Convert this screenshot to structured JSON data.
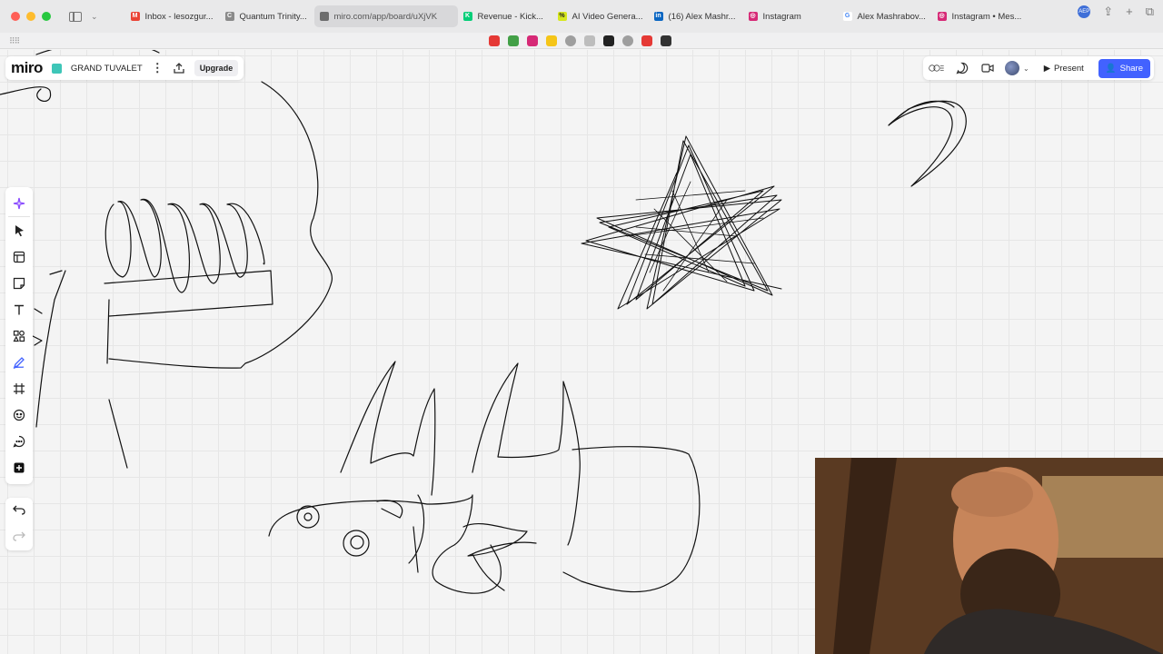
{
  "browser": {
    "tabs": [
      {
        "label": "Inbox - lesozgur...",
        "icon_color": "#ea4335",
        "icon_glyph": "M",
        "active": false
      },
      {
        "label": "Quantum Trinity...",
        "icon_color": "#8a8a8a",
        "icon_glyph": "C",
        "active": false
      },
      {
        "label": "miro.com/app/board/uXjVK",
        "icon_color": "#6d6d6d",
        "icon_glyph": "",
        "active": true
      },
      {
        "label": "Revenue - Kick...",
        "icon_color": "#05ce78",
        "icon_glyph": "K",
        "active": false
      },
      {
        "label": "AI Video Genera...",
        "icon_color": "#d7e81e",
        "icon_glyph": "%",
        "active": false
      },
      {
        "label": "(16) Alex Mashr...",
        "icon_color": "#0a66c2",
        "icon_glyph": "in",
        "active": false
      },
      {
        "label": "Instagram",
        "icon_color": "#d62976",
        "icon_glyph": "◎",
        "active": false
      },
      {
        "label": "Alex Mashrabov...",
        "icon_color": "#ffffff",
        "icon_glyph": "G",
        "active": false
      },
      {
        "label": "Instagram • Mes...",
        "icon_color": "#d62976",
        "icon_glyph": "◎",
        "active": false
      }
    ],
    "bookmark_colors": [
      "#e53935",
      "#43a047",
      "#d62976",
      "#f5c518",
      "#9e9e9e",
      "#bdbdbd",
      "#222222",
      "#9e9e9e",
      "#e53935",
      "#333333"
    ]
  },
  "board": {
    "logo": "miro",
    "name": "GRAND TUVALET",
    "upgrade_label": "Upgrade"
  },
  "topbar": {
    "present_label": "Present",
    "share_label": "Share",
    "accent": "#4262ff"
  },
  "toolbar": {
    "tools": [
      "ai-sparkle-icon",
      "select-cursor-icon",
      "templates-icon",
      "sticky-note-icon",
      "text-icon",
      "shapes-icon",
      "pen-icon",
      "frame-icon",
      "stickers-icon",
      "comment-icon",
      "more-tools-icon"
    ],
    "active_tool": "pen-icon"
  }
}
